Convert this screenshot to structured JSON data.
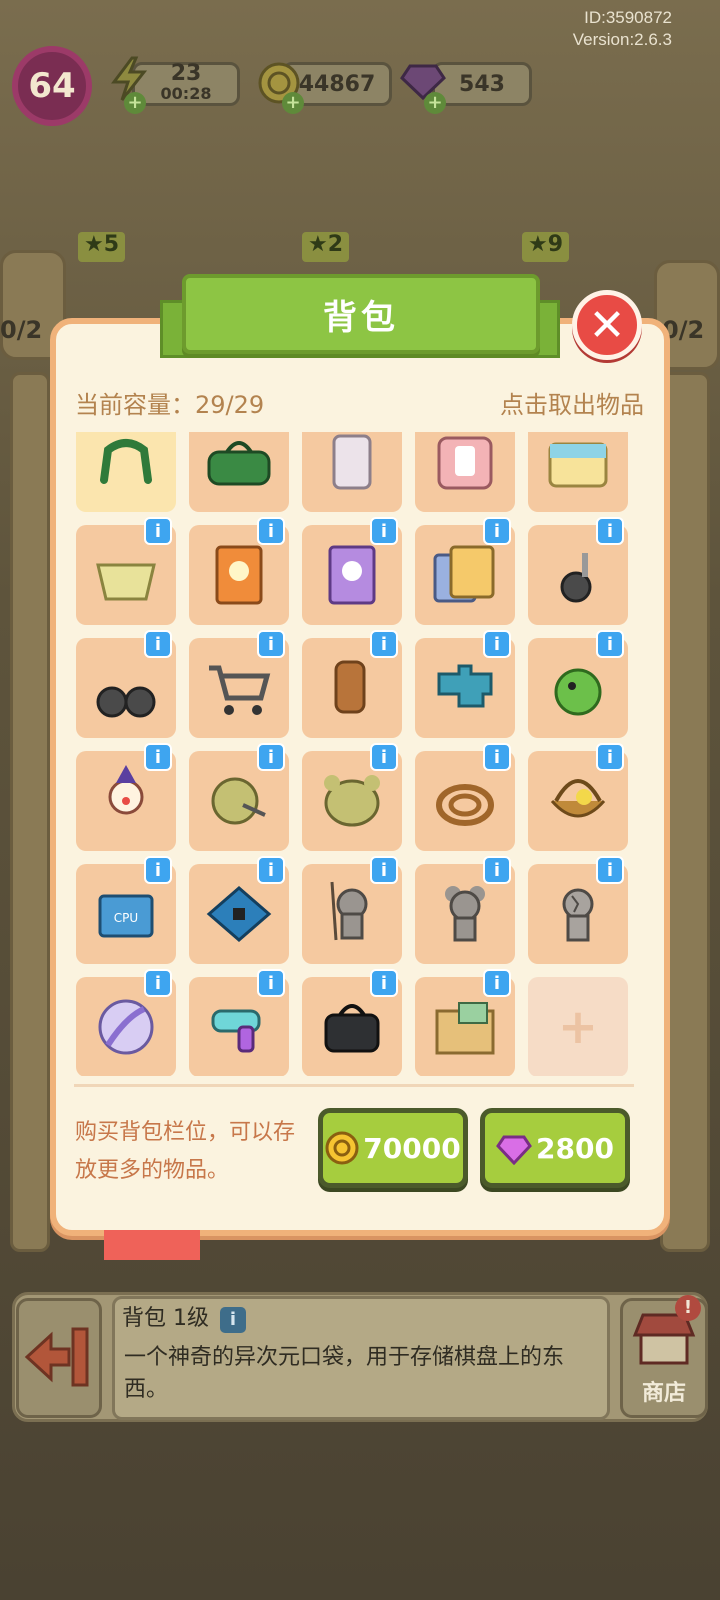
{
  "meta": {
    "id": "ID:3590872",
    "version": "Version:2.6.3"
  },
  "hud": {
    "level": "64",
    "energy": "23",
    "energy_timer": "00:28",
    "coins": "44867",
    "gems": "543"
  },
  "side": {
    "star_left": "5",
    "star_mid": "2",
    "star_right": "9",
    "count_left": "0/2",
    "count_right": "0/2"
  },
  "panel": {
    "title": "背包",
    "capacity_label": "当前容量：29/29",
    "take_hint": "点击取出物品",
    "buy_hint": "购买背包栏位，可以存放更多的物品。",
    "buy_coin_price": "70000",
    "buy_gem_price": "2800"
  },
  "items": [
    {
      "name": "green-horseshoe",
      "info": false
    },
    {
      "name": "green-bag",
      "info": false
    },
    {
      "name": "white-robot-piece",
      "info": false
    },
    {
      "name": "pink-suitcase",
      "info": false
    },
    {
      "name": "first-aid-kit",
      "info": false
    },
    {
      "name": "wire-basket",
      "info": true
    },
    {
      "name": "orange-book-2",
      "info": true
    },
    {
      "name": "purple-book-3",
      "info": true
    },
    {
      "name": "book-stack",
      "info": true
    },
    {
      "name": "single-caster-wheel",
      "info": true
    },
    {
      "name": "double-caster-wheel",
      "info": true
    },
    {
      "name": "shopping-cart",
      "info": true
    },
    {
      "name": "tree-stump",
      "info": true
    },
    {
      "name": "blue-puzzle",
      "info": true
    },
    {
      "name": "green-dino-plush",
      "info": true
    },
    {
      "name": "clown-figurine",
      "info": true
    },
    {
      "name": "bear-fabric-scissors",
      "info": true
    },
    {
      "name": "bear-fabric",
      "info": true
    },
    {
      "name": "rope-coil",
      "info": true
    },
    {
      "name": "flower-basket",
      "info": true
    },
    {
      "name": "cpu-chip",
      "info": true
    },
    {
      "name": "circuit-board",
      "info": true
    },
    {
      "name": "mouse-statue-spear",
      "info": true
    },
    {
      "name": "mouse-statue",
      "info": true
    },
    {
      "name": "mouse-statue-cracked",
      "info": true
    },
    {
      "name": "beach-ball",
      "info": true
    },
    {
      "name": "water-gun",
      "info": true
    },
    {
      "name": "black-handbag",
      "info": true
    },
    {
      "name": "cardboard-box",
      "info": true
    }
  ],
  "empty_slot": "+",
  "bottom": {
    "item_title": "背包 1级",
    "item_desc": "一个神奇的异次元口袋，用于存储棋盘上的东西。",
    "shop_label": "商店"
  },
  "colors": {
    "accent_green": "#8dc544",
    "panel_bg": "#fbf3df",
    "cell_bg": "#f5c9a0",
    "info_blue": "#3ea5f0",
    "close_red": "#e84b45"
  }
}
